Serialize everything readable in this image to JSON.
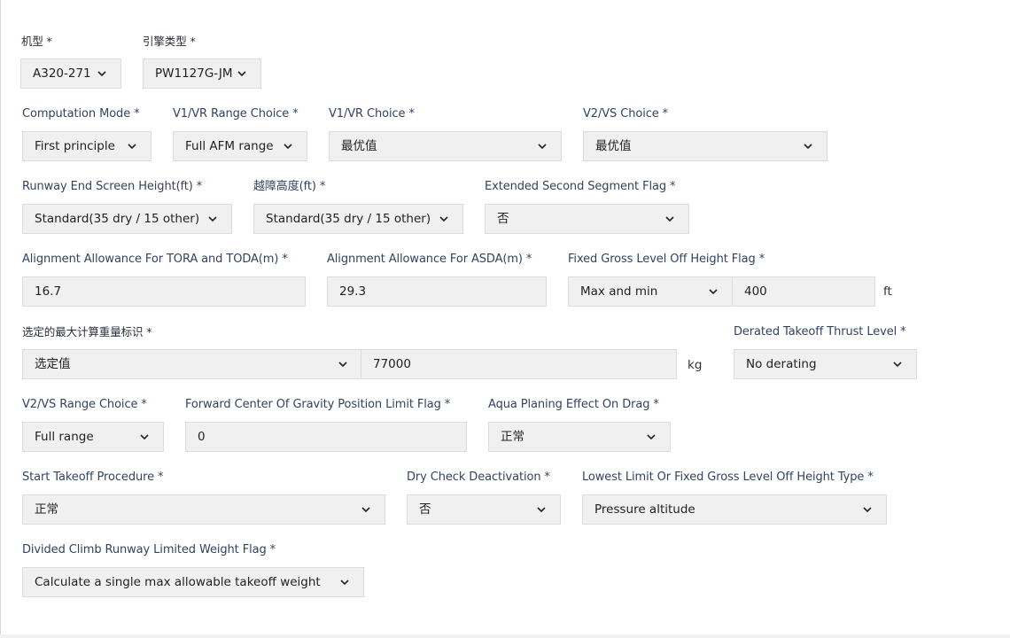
{
  "aircraft_type": {
    "label": "机型 *",
    "value": "A320-271"
  },
  "engine_type": {
    "label": "引擎类型 *",
    "value": "PW1127G-JM"
  },
  "computation_mode": {
    "label": "Computation Mode *",
    "value": "First principle"
  },
  "v1vr_range_choice": {
    "label": "V1/VR Range Choice *",
    "value": "Full AFM range"
  },
  "v1vr_choice": {
    "label": "V1/VR Choice *",
    "value": "最优值"
  },
  "v2vs_choice": {
    "label": "V2/VS Choice *",
    "value": "最优值"
  },
  "runway_end_screen_height": {
    "label": "Runway End Screen Height(ft) *",
    "value": "Standard(35 dry / 15 other)"
  },
  "obstacle_clearance_height": {
    "label": "越障高度(ft) *",
    "value": "Standard(35 dry / 15 other)"
  },
  "extended_second_segment": {
    "label": "Extended Second Segment Flag *",
    "value": "否"
  },
  "alignment_tora_toda": {
    "label": "Alignment Allowance For TORA and TODA(m) *",
    "value": "16.7"
  },
  "alignment_asda": {
    "label": "Alignment Allowance For ASDA(m) *",
    "value": "29.3"
  },
  "fixed_gross_level_off": {
    "label": "Fixed Gross Level Off Height Flag *",
    "value": "Max and min",
    "height_value": "400",
    "unit": "ft"
  },
  "max_calc_weight": {
    "label": "选定的最大计算重量标识 *",
    "value": "选定值",
    "weight_value": "77000",
    "unit": "kg"
  },
  "derated_thrust": {
    "label": "Derated Takeoff Thrust Level *",
    "value": "No derating"
  },
  "v2vs_range_choice": {
    "label": "V2/VS Range Choice *",
    "value": "Full range"
  },
  "forward_cg_limit": {
    "label": "Forward Center Of Gravity Position Limit Flag *",
    "value": "0"
  },
  "aqua_planing": {
    "label": "Aqua Planing Effect On Drag *",
    "value": "正常"
  },
  "start_takeoff_procedure": {
    "label": "Start Takeoff Procedure *",
    "value": "正常"
  },
  "dry_check_deactivation": {
    "label": "Dry Check Deactivation *",
    "value": "否"
  },
  "lowest_limit_type": {
    "label": "Lowest Limit Or Fixed Gross Level Off Height Type *",
    "value": "Pressure altitude"
  },
  "divided_climb": {
    "label": "Divided Climb Runway Limited Weight Flag *",
    "value": "Calculate a single max allowable takeoff weight"
  },
  "icons": {
    "dropdown": "chevron-down-icon"
  }
}
